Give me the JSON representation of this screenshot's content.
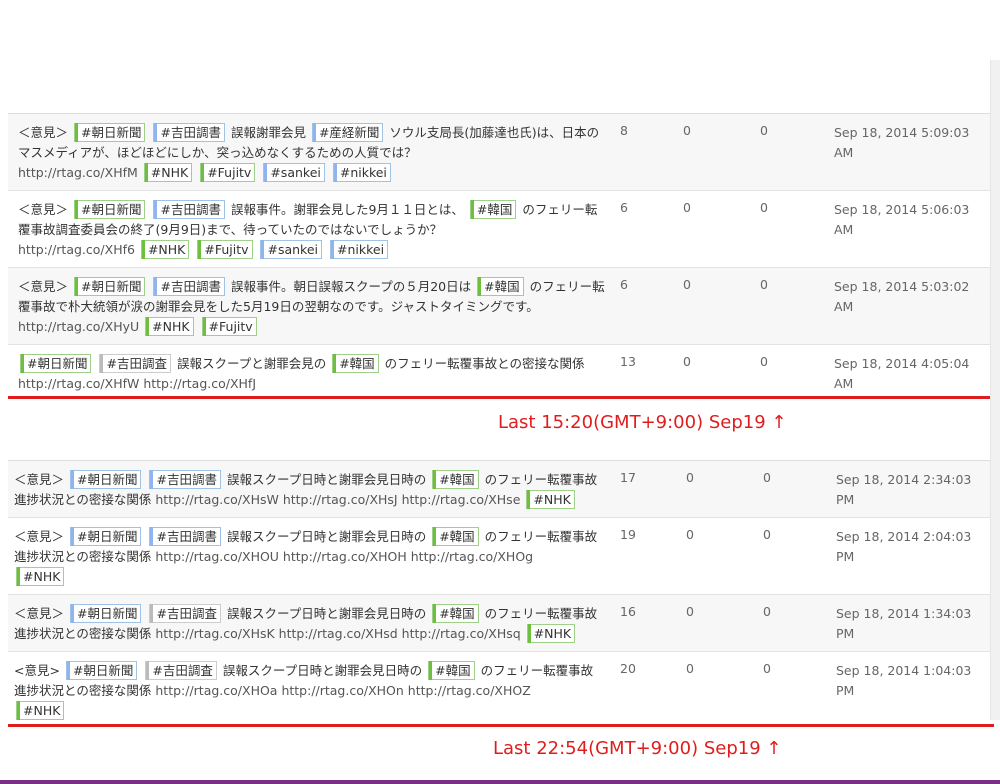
{
  "block1": [
    {
      "prefix": "＜意見＞",
      "segments1": [
        {
          "t": "tag",
          "c": "green",
          "v": "#朝日新聞"
        },
        {
          "t": "tag",
          "c": "blue",
          "v": "#吉田調書"
        },
        {
          "t": "text",
          "v": "誤報謝罪会見"
        },
        {
          "t": "tag",
          "c": "blue",
          "v": "#産経新聞"
        },
        {
          "t": "text",
          "v": "ソウル支局長(加藤達也氏)は、日本のマスメディアが、ほどほどにしか、突っ込めなくするための人質では？"
        }
      ],
      "segments2": [
        {
          "t": "url",
          "v": "http://rtag.co/XHfM"
        },
        {
          "t": "tag",
          "c": "green",
          "v": "#NHK"
        },
        {
          "t": "tag",
          "c": "green",
          "v": "#Fujitv"
        },
        {
          "t": "tag",
          "c": "blue",
          "v": "#sankei"
        },
        {
          "t": "tag",
          "c": "blue",
          "v": "#nikkei"
        }
      ],
      "c1": "8",
      "c2": "0",
      "c3": "0",
      "date": "Sep 18, 2014 5:09:03 AM"
    },
    {
      "prefix": "＜意見＞",
      "segments1": [
        {
          "t": "tag",
          "c": "green",
          "v": "#朝日新聞"
        },
        {
          "t": "tag",
          "c": "blue",
          "v": "#吉田調書"
        },
        {
          "t": "text",
          "v": "誤報事件。謝罪会見した9月１１日とは、"
        },
        {
          "t": "tag",
          "c": "green",
          "v": "#韓国"
        },
        {
          "t": "text",
          "v": "のフェリー転覆事故調査委員会の終了(9月9日)まで、待っていたのではないでしょうか？"
        }
      ],
      "segments2": [
        {
          "t": "url",
          "v": "http://rtag.co/XHf6"
        },
        {
          "t": "tag",
          "c": "green",
          "v": "#NHK"
        },
        {
          "t": "tag",
          "c": "green",
          "v": "#Fujitv"
        },
        {
          "t": "tag",
          "c": "blue",
          "v": "#sankei"
        },
        {
          "t": "tag",
          "c": "blue",
          "v": "#nikkei"
        }
      ],
      "c1": "6",
      "c2": "0",
      "c3": "0",
      "date": "Sep 18, 2014 5:06:03 AM"
    },
    {
      "prefix": "＜意見＞",
      "segments1": [
        {
          "t": "tag",
          "c": "green",
          "v": "#朝日新聞"
        },
        {
          "t": "tag",
          "c": "blue",
          "v": "#吉田調書"
        },
        {
          "t": "text",
          "v": "誤報事件。朝日誤報スクープの５月20日は"
        },
        {
          "t": "tag",
          "c": "green",
          "v": "#韓国"
        },
        {
          "t": "text",
          "v": "のフェリー転覆事故で朴大統領が涙の謝罪会見をした5月19日の翌朝なのです。ジャストタイミングです。"
        }
      ],
      "segments2": [
        {
          "t": "url",
          "v": "http://rtag.co/XHyU"
        },
        {
          "t": "tag",
          "c": "green",
          "v": "#NHK"
        },
        {
          "t": "tag",
          "c": "green",
          "v": "#Fujitv"
        }
      ],
      "c1": "6",
      "c2": "0",
      "c3": "0",
      "date": "Sep 18, 2014 5:03:02 AM"
    },
    {
      "prefix": "",
      "segments1": [
        {
          "t": "tag",
          "c": "green",
          "v": "#朝日新聞"
        },
        {
          "t": "tag",
          "c": "gray",
          "v": "#吉田調査"
        },
        {
          "t": "text",
          "v": "誤報スクープと謝罪会見の"
        },
        {
          "t": "tag",
          "c": "green",
          "v": "#韓国"
        },
        {
          "t": "text",
          "v": "のフェリー転覆事故との密接な関係"
        }
      ],
      "segments2": [
        {
          "t": "url",
          "v": "http://rtag.co/XHfW http://rtag.co/XHfJ"
        }
      ],
      "c1": "13",
      "c2": "0",
      "c3": "0",
      "date": "Sep 18, 2014 4:05:04 AM"
    }
  ],
  "note1": "Last 15:20(GMT+9:00) Sep19 ↑",
  "block2": [
    {
      "prefix": "＜意見＞",
      "segments1": [
        {
          "t": "tag",
          "c": "blue",
          "v": "#朝日新聞"
        },
        {
          "t": "tag",
          "c": "blue",
          "v": "#吉田調書"
        },
        {
          "t": "text",
          "v": "誤報スクープ日時と謝罪会見日時の"
        },
        {
          "t": "tag",
          "c": "green",
          "v": "#韓国"
        },
        {
          "t": "text",
          "v": "のフェリー転覆事故進捗状況との密接な関係"
        },
        {
          "t": "url",
          "v": "http://rtag.co/XHsW http://rtag.co/XHsJ  http://rtag.co/XHse"
        },
        {
          "t": "tag",
          "c": "green",
          "v": "#NHK"
        }
      ],
      "segments2": [],
      "c1": "17",
      "c2": "0",
      "c3": "0",
      "date": "Sep 18, 2014 2:34:03 PM"
    },
    {
      "prefix": "＜意見＞",
      "segments1": [
        {
          "t": "tag",
          "c": "blue",
          "v": "#朝日新聞"
        },
        {
          "t": "tag",
          "c": "blue",
          "v": "#吉田調書"
        },
        {
          "t": "text",
          "v": "誤報スクープ日時と謝罪会見日時の"
        },
        {
          "t": "tag",
          "c": "green",
          "v": "#韓国"
        },
        {
          "t": "text",
          "v": "のフェリー転覆事故進捗状況との密接な関係"
        },
        {
          "t": "url",
          "v": "  http://rtag.co/XHOU http://rtag.co/XHOH  http://rtag.co/XHOg"
        }
      ],
      "segments2": [
        {
          "t": "tag",
          "c": "green",
          "v": "#NHK"
        }
      ],
      "c1": "19",
      "c2": "0",
      "c3": "0",
      "date": "Sep 18, 2014 2:04:03 PM"
    },
    {
      "prefix": "＜意見＞",
      "segments1": [
        {
          "t": "tag",
          "c": "blue",
          "v": "#朝日新聞"
        },
        {
          "t": "tag",
          "c": "gray",
          "v": "#吉田調査"
        },
        {
          "t": "text",
          "v": "誤報スクープ日時と謝罪会見日時の"
        },
        {
          "t": "tag",
          "c": "green",
          "v": "#韓国"
        },
        {
          "t": "text",
          "v": "のフェリー転覆事故進捗状況との密接な関係"
        },
        {
          "t": "url",
          "v": "http://rtag.co/XHsK http://rtag.co/XHsd  http://rtag.co/XHsq"
        },
        {
          "t": "tag",
          "c": "green",
          "v": "#NHK"
        }
      ],
      "segments2": [],
      "c1": "16",
      "c2": "0",
      "c3": "0",
      "date": "Sep 18, 2014 1:34:03 PM"
    },
    {
      "prefix": "<意見>",
      "segments1": [
        {
          "t": "tag",
          "c": "blue",
          "v": "#朝日新聞"
        },
        {
          "t": "tag",
          "c": "gray",
          "v": "#吉田調査"
        },
        {
          "t": "text",
          "v": "誤報スクープ日時と謝罪会見日時の"
        },
        {
          "t": "tag",
          "c": "green",
          "v": "#韓国"
        },
        {
          "t": "text",
          "v": "のフェリー転覆事故進捗状況との密接な関係"
        },
        {
          "t": "url",
          "v": "   http://rtag.co/XHOa   http://rtag.co/XHOn    http://rtag.co/XHOZ"
        }
      ],
      "segments2": [
        {
          "t": "tag",
          "c": "green",
          "v": "#NHK"
        }
      ],
      "c1": "20",
      "c2": "0",
      "c3": "0",
      "date": "Sep 18, 2014 1:04:03 PM"
    }
  ],
  "note2": "Last 22:54(GMT+9:00) Sep19 ↑",
  "colors": {
    "accent_red": "#e01d1d",
    "tag_green": "#6fbf3f",
    "tag_blue": "#8fb4f0"
  }
}
